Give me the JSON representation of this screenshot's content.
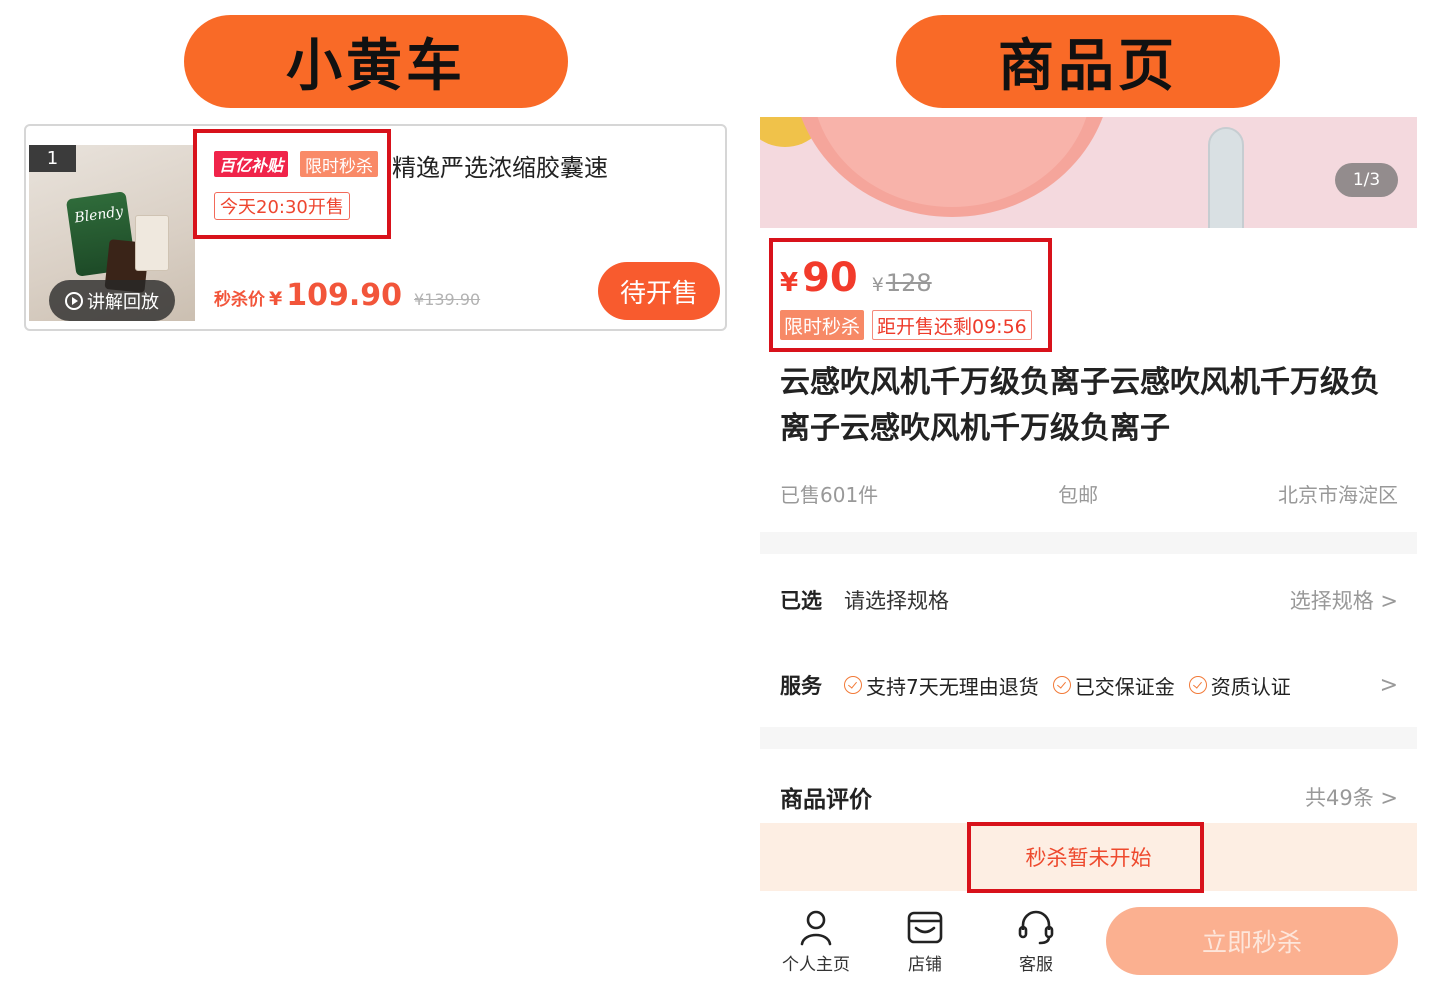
{
  "headers": {
    "left_label": "小黄车",
    "right_label": "商品页"
  },
  "cart_card": {
    "rank": "1",
    "replay_label": "讲解回放",
    "thumb_brand": "Blendy",
    "tag_subsidy": "百亿补贴",
    "tag_flash": "限时秒杀",
    "title": "精逸严选浓缩胶囊速",
    "sale_time": "今天20:30开售",
    "price_label": "秒杀价",
    "price_yen": "¥",
    "price": "109.90",
    "original_price": "¥139.90",
    "button_label": "待开售"
  },
  "product_page": {
    "image_counter": "1/3",
    "price_yen": "¥",
    "price": "90",
    "original_yen": "¥",
    "original_price": "128",
    "tag_flash": "限时秒杀",
    "countdown": "距开售还剩09:56",
    "title": "云感吹风机千万级负离子云感吹风机千万级负离子云感吹风机千万级负离子",
    "sold": "已售601件",
    "shipping": "包邮",
    "location": "北京市海淀区",
    "spec": {
      "label": "已选",
      "value": "请选择规格",
      "action": "选择规格 >"
    },
    "service": {
      "label": "服务",
      "items": [
        "支持7天无理由退货",
        "已交保证金",
        "资质认证"
      ],
      "chevron": ">"
    },
    "reviews": {
      "title": "商品评价",
      "count": "共49条 >"
    },
    "notice": "秒杀暂未开始",
    "bottom": {
      "profile": "个人主页",
      "store": "店铺",
      "service": "客服",
      "buy": "立即秒杀"
    }
  },
  "colors": {
    "pill": "#f96a27",
    "highlight": "#d8121b",
    "price": "#f23b2b",
    "button": "#f85b2e",
    "buy_disabled": "#fbb090"
  },
  "icons": {
    "play": "play-circle-icon",
    "check": "check-circle-icon",
    "profile": "person-icon",
    "store": "store-icon",
    "service": "headset-icon"
  }
}
